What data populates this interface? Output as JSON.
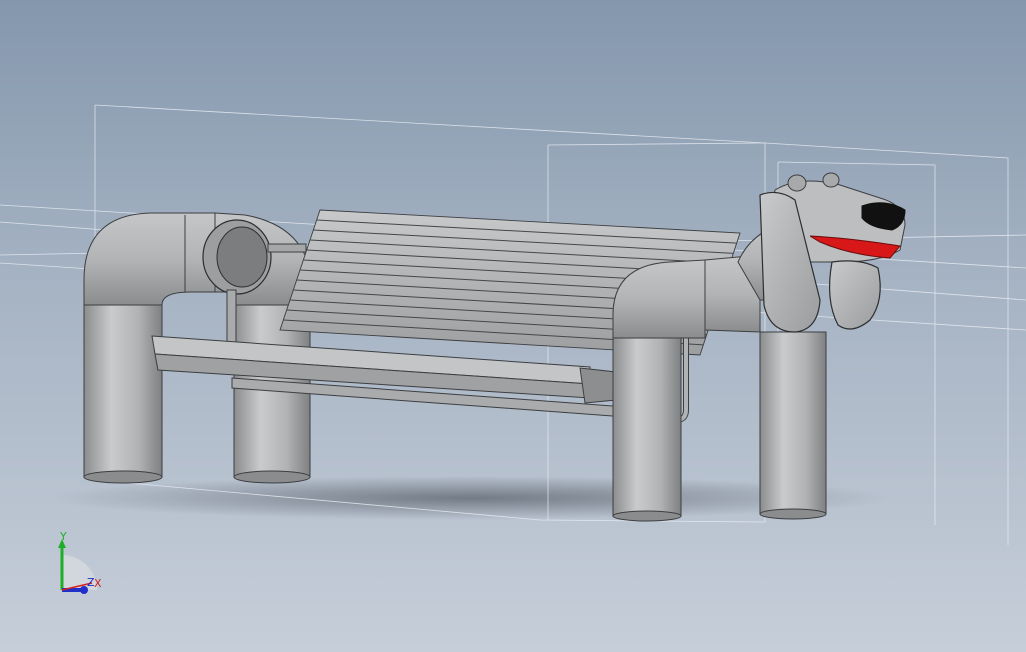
{
  "viewport": {
    "background_top": "#8497ad",
    "background_bottom": "#c6ced9",
    "model_color": "#b4b6b8",
    "tongue_color": "#d81818",
    "nose_color": "#111111"
  },
  "triad": {
    "x_label": "X",
    "y_label": "Y",
    "z_label": "Z",
    "x_color": "#d42020",
    "y_color": "#1fae2a",
    "z_color": "#2030c8"
  }
}
